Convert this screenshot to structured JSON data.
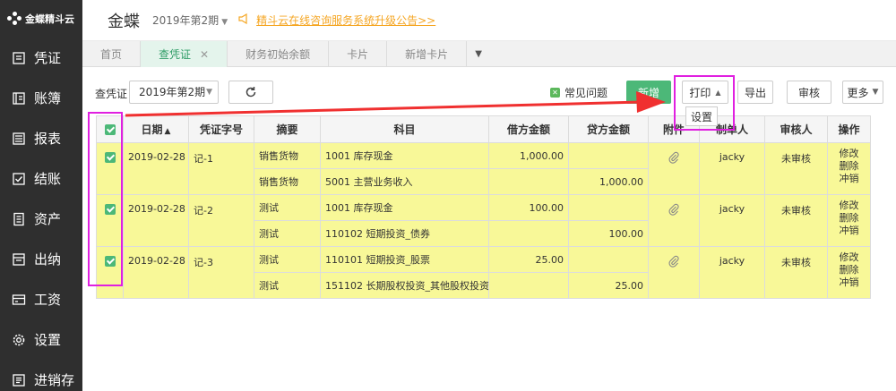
{
  "sidebar": {
    "logo": "金蝶精斗云",
    "items": [
      {
        "label": "凭证",
        "icon": "voucher-icon"
      },
      {
        "label": "账簿",
        "icon": "ledger-icon"
      },
      {
        "label": "报表",
        "icon": "report-icon"
      },
      {
        "label": "结账",
        "icon": "checkout-icon"
      },
      {
        "label": "资产",
        "icon": "asset-icon"
      },
      {
        "label": "出纳",
        "icon": "cashier-icon"
      },
      {
        "label": "工资",
        "icon": "salary-icon"
      },
      {
        "label": "设置",
        "icon": "gear-icon"
      },
      {
        "label": "进销存",
        "icon": "inventory-icon"
      }
    ]
  },
  "header": {
    "brand": "金蝶",
    "period": "2019年第2期",
    "notice": "精斗云在线咨询服务系统升级公告>>"
  },
  "tabs": [
    {
      "label": "首页",
      "active": false
    },
    {
      "label": "查凭证",
      "active": true
    },
    {
      "label": "财务初始余额",
      "active": false
    },
    {
      "label": "卡片",
      "active": false
    },
    {
      "label": "新增卡片",
      "active": false
    }
  ],
  "toolbar": {
    "label": "查凭证",
    "period": "2019年第2期",
    "faq": "常见问题",
    "new": "新增",
    "print": "打印",
    "print_menu": "设置",
    "export": "导出",
    "audit": "审核",
    "more": "更多"
  },
  "table": {
    "headers": [
      "日期",
      "凭证字号",
      "摘要",
      "科目",
      "借方金额",
      "贷方金额",
      "附件",
      "制单人",
      "审核人",
      "操作"
    ],
    "vouchers": [
      {
        "date": "2019-02-28",
        "number": "记-1",
        "maker": "jacky",
        "status": "未审核",
        "ops": [
          "修改",
          "删除",
          "冲销"
        ],
        "lines": [
          {
            "summary": "销售货物",
            "account": "1001 库存现金",
            "debit": "1,000.00",
            "credit": ""
          },
          {
            "summary": "销售货物",
            "account": "5001 主营业务收入",
            "debit": "",
            "credit": "1,000.00"
          }
        ]
      },
      {
        "date": "2019-02-28",
        "number": "记-2",
        "maker": "jacky",
        "status": "未审核",
        "ops": [
          "修改",
          "删除",
          "冲销"
        ],
        "lines": [
          {
            "summary": "测试",
            "account": "1001 库存现金",
            "debit": "100.00",
            "credit": ""
          },
          {
            "summary": "测试",
            "account": "110102 短期投资_债券",
            "debit": "",
            "credit": "100.00"
          }
        ]
      },
      {
        "date": "2019-02-28",
        "number": "记-3",
        "maker": "jacky",
        "status": "未审核",
        "ops": [
          "修改",
          "删除",
          "冲销"
        ],
        "lines": [
          {
            "summary": "测试",
            "account": "110101 短期投资_股票",
            "debit": "25.00",
            "credit": ""
          },
          {
            "summary": "测试",
            "account": "151102 长期股权投资_其他股权投资",
            "debit": "",
            "credit": "25.00"
          }
        ]
      }
    ]
  },
  "colors": {
    "accent": "#4cb878",
    "highlight": "#e020e0",
    "arrow": "#f03030",
    "row_bg": "#f8f898"
  }
}
